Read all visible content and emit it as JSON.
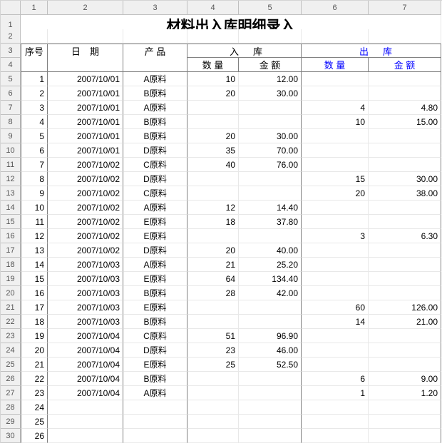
{
  "title": "材料出入库明细录入",
  "colHeaders": [
    "1",
    "2",
    "3",
    "4",
    "5",
    "6",
    "7"
  ],
  "rowHeaders": [
    "1",
    "2",
    "3",
    "4",
    "5",
    "6",
    "7",
    "8",
    "9",
    "10",
    "11",
    "12",
    "13",
    "14",
    "15",
    "16",
    "17",
    "18",
    "19",
    "20",
    "21",
    "22",
    "23",
    "24",
    "25",
    "26",
    "27",
    "28",
    "29",
    "30"
  ],
  "headers": {
    "seq": "序号",
    "date": "日　期",
    "product": "产 品",
    "inGroup": "入　　库",
    "outGroup": "出　　库",
    "qty": "数 量",
    "amt": "金 额"
  },
  "rows": [
    {
      "seq": "1",
      "date": "2007/10/01",
      "product": "A原料",
      "inQty": "10",
      "inAmt": "12.00",
      "outQty": "",
      "outAmt": ""
    },
    {
      "seq": "2",
      "date": "2007/10/01",
      "product": "B原料",
      "inQty": "20",
      "inAmt": "30.00",
      "outQty": "",
      "outAmt": ""
    },
    {
      "seq": "3",
      "date": "2007/10/01",
      "product": "A原料",
      "inQty": "",
      "inAmt": "",
      "outQty": "4",
      "outAmt": "4.80"
    },
    {
      "seq": "4",
      "date": "2007/10/01",
      "product": "B原料",
      "inQty": "",
      "inAmt": "",
      "outQty": "10",
      "outAmt": "15.00"
    },
    {
      "seq": "5",
      "date": "2007/10/01",
      "product": "B原料",
      "inQty": "20",
      "inAmt": "30.00",
      "outQty": "",
      "outAmt": ""
    },
    {
      "seq": "6",
      "date": "2007/10/01",
      "product": "D原料",
      "inQty": "35",
      "inAmt": "70.00",
      "outQty": "",
      "outAmt": ""
    },
    {
      "seq": "7",
      "date": "2007/10/02",
      "product": "C原料",
      "inQty": "40",
      "inAmt": "76.00",
      "outQty": "",
      "outAmt": ""
    },
    {
      "seq": "8",
      "date": "2007/10/02",
      "product": "D原料",
      "inQty": "",
      "inAmt": "",
      "outQty": "15",
      "outAmt": "30.00"
    },
    {
      "seq": "9",
      "date": "2007/10/02",
      "product": "C原料",
      "inQty": "",
      "inAmt": "",
      "outQty": "20",
      "outAmt": "38.00"
    },
    {
      "seq": "10",
      "date": "2007/10/02",
      "product": "A原料",
      "inQty": "12",
      "inAmt": "14.40",
      "outQty": "",
      "outAmt": ""
    },
    {
      "seq": "11",
      "date": "2007/10/02",
      "product": "E原料",
      "inQty": "18",
      "inAmt": "37.80",
      "outQty": "",
      "outAmt": ""
    },
    {
      "seq": "12",
      "date": "2007/10/02",
      "product": "E原料",
      "inQty": "",
      "inAmt": "",
      "outQty": "3",
      "outAmt": "6.30"
    },
    {
      "seq": "13",
      "date": "2007/10/02",
      "product": "D原料",
      "inQty": "20",
      "inAmt": "40.00",
      "outQty": "",
      "outAmt": ""
    },
    {
      "seq": "14",
      "date": "2007/10/03",
      "product": "A原料",
      "inQty": "21",
      "inAmt": "25.20",
      "outQty": "",
      "outAmt": ""
    },
    {
      "seq": "15",
      "date": "2007/10/03",
      "product": "E原料",
      "inQty": "64",
      "inAmt": "134.40",
      "outQty": "",
      "outAmt": ""
    },
    {
      "seq": "16",
      "date": "2007/10/03",
      "product": "B原料",
      "inQty": "28",
      "inAmt": "42.00",
      "outQty": "",
      "outAmt": ""
    },
    {
      "seq": "17",
      "date": "2007/10/03",
      "product": "E原料",
      "inQty": "",
      "inAmt": "",
      "outQty": "60",
      "outAmt": "126.00"
    },
    {
      "seq": "18",
      "date": "2007/10/03",
      "product": "B原料",
      "inQty": "",
      "inAmt": "",
      "outQty": "14",
      "outAmt": "21.00"
    },
    {
      "seq": "19",
      "date": "2007/10/04",
      "product": "C原料",
      "inQty": "51",
      "inAmt": "96.90",
      "outQty": "",
      "outAmt": ""
    },
    {
      "seq": "20",
      "date": "2007/10/04",
      "product": "D原料",
      "inQty": "23",
      "inAmt": "46.00",
      "outQty": "",
      "outAmt": ""
    },
    {
      "seq": "21",
      "date": "2007/10/04",
      "product": "E原料",
      "inQty": "25",
      "inAmt": "52.50",
      "outQty": "",
      "outAmt": ""
    },
    {
      "seq": "22",
      "date": "2007/10/04",
      "product": "B原料",
      "inQty": "",
      "inAmt": "",
      "outQty": "6",
      "outAmt": "9.00"
    },
    {
      "seq": "23",
      "date": "2007/10/04",
      "product": "A原料",
      "inQty": "",
      "inAmt": "",
      "outQty": "1",
      "outAmt": "1.20"
    },
    {
      "seq": "24",
      "date": "",
      "product": "",
      "inQty": "",
      "inAmt": "",
      "outQty": "",
      "outAmt": ""
    },
    {
      "seq": "25",
      "date": "",
      "product": "",
      "inQty": "",
      "inAmt": "",
      "outQty": "",
      "outAmt": ""
    },
    {
      "seq": "26",
      "date": "",
      "product": "",
      "inQty": "",
      "inAmt": "",
      "outQty": "",
      "outAmt": ""
    }
  ]
}
